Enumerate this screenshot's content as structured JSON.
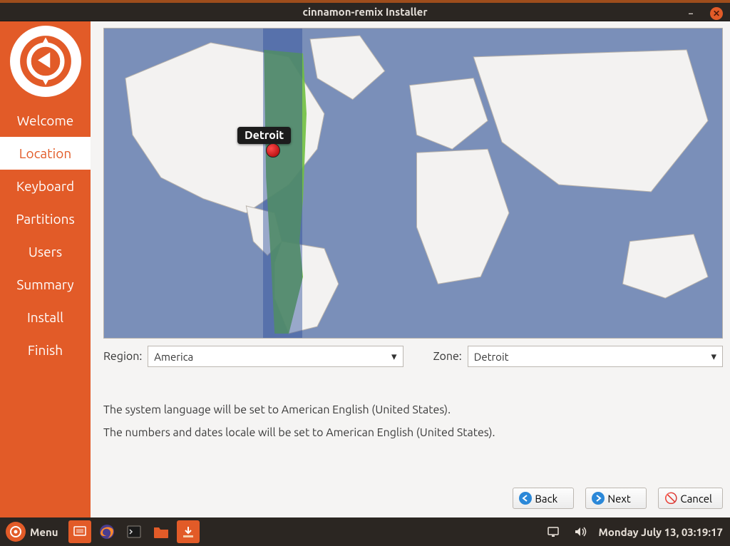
{
  "window": {
    "title": "cinnamon-remix Installer"
  },
  "sidebar": {
    "steps": [
      {
        "label": "Welcome"
      },
      {
        "label": "Location"
      },
      {
        "label": "Keyboard"
      },
      {
        "label": "Partitions"
      },
      {
        "label": "Users"
      },
      {
        "label": "Summary"
      },
      {
        "label": "Install"
      },
      {
        "label": "Finish"
      }
    ],
    "active_index": 1
  },
  "map": {
    "pin_label": "Detroit"
  },
  "form": {
    "region_label": "Region:",
    "region_value": "America",
    "zone_label": "Zone:",
    "zone_value": "Detroit"
  },
  "info": {
    "line1": "The system language will be set to American English (United States).",
    "line2": "The numbers and dates locale will be set to American English (United States)."
  },
  "nav": {
    "back": "Back",
    "next": "Next",
    "cancel": "Cancel"
  },
  "panel": {
    "menu": "Menu",
    "clock": "Monday July 13, 03:19:17"
  }
}
